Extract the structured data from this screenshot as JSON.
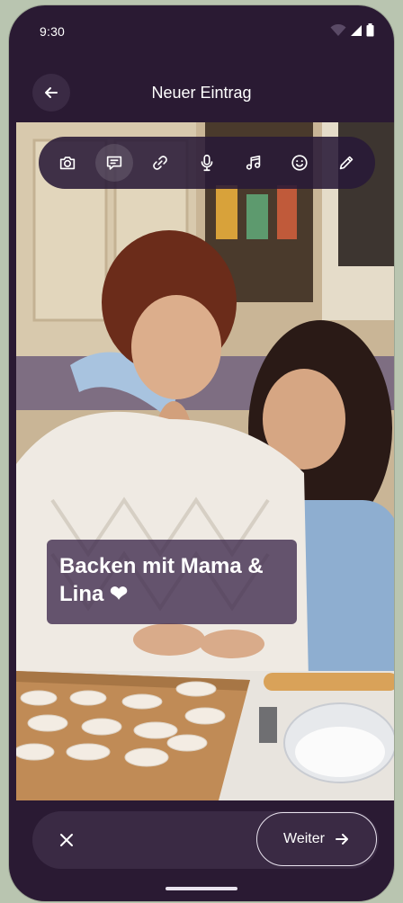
{
  "status": {
    "time": "9:30"
  },
  "header": {
    "title": "Neuer Eintrag",
    "back_icon": "arrow-left-icon"
  },
  "toolbar": {
    "items": [
      {
        "icon": "camera-icon"
      },
      {
        "icon": "text-comment-icon",
        "active": true
      },
      {
        "icon": "link-icon"
      },
      {
        "icon": "microphone-icon"
      },
      {
        "icon": "music-note-icon"
      },
      {
        "icon": "emoji-icon"
      },
      {
        "icon": "pencil-icon"
      }
    ]
  },
  "caption": {
    "text": "Backen mit Mama & Lina ❤"
  },
  "footer": {
    "close_icon": "close-icon",
    "next_label": "Weiter",
    "next_icon": "arrow-right-icon"
  },
  "colors": {
    "background": "#2a1a33",
    "surface": "#3a2a44",
    "text": "#ffffff",
    "outside": "#b9c5b0"
  }
}
